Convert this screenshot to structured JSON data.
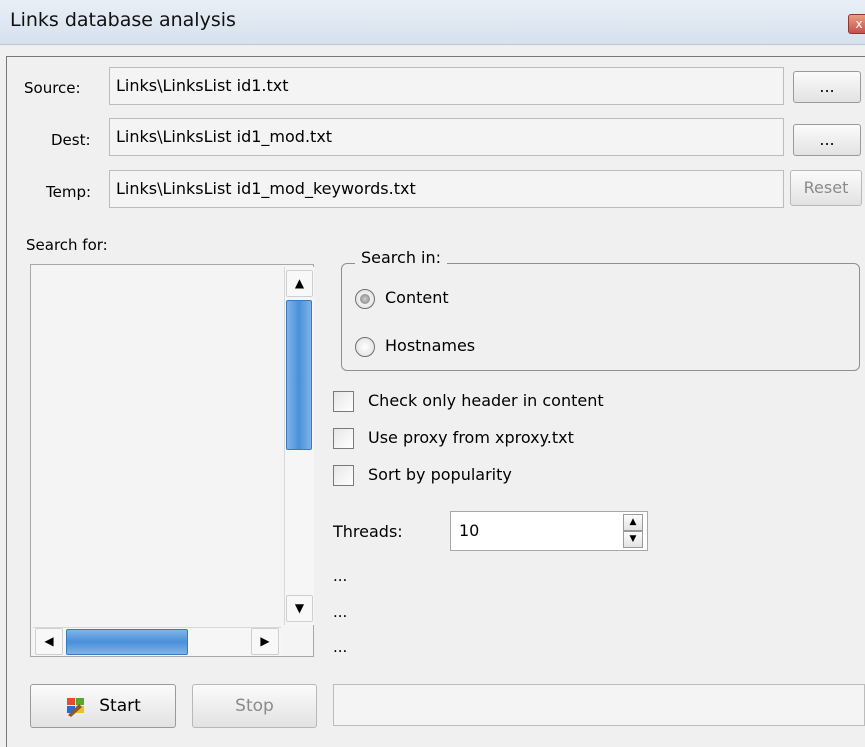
{
  "window": {
    "title": "Links database analysis",
    "close_glyph": "x"
  },
  "source": {
    "label": "Source:",
    "value": "Links\\LinksList id1.txt",
    "browse_label": "..."
  },
  "dest": {
    "label": "Dest:",
    "value": "Links\\LinksList id1_mod.txt",
    "browse_label": "..."
  },
  "temp": {
    "label": "Temp:",
    "value": "Links\\LinksList id1_mod_keywords.txt",
    "reset_label": "Reset"
  },
  "search_for": {
    "label": "Search for:",
    "items": []
  },
  "search_in": {
    "legend": "Search in:",
    "options": [
      {
        "label": "Content",
        "selected": true
      },
      {
        "label": "Hostnames",
        "selected": false
      }
    ]
  },
  "options": {
    "check_header": {
      "label": "Check only header in content",
      "checked": false
    },
    "use_proxy": {
      "label": "Use proxy from xproxy.txt",
      "checked": false
    },
    "sort_popularity": {
      "label": "Sort by popularity",
      "checked": false
    }
  },
  "threads": {
    "label": "Threads:",
    "value": "10"
  },
  "status_lines": [
    "...",
    "...",
    "..."
  ],
  "buttons": {
    "start": "Start",
    "stop": "Stop"
  },
  "status_box": {
    "text": ""
  },
  "icons": {
    "start_icon": "start-icon",
    "scroll_up": "▲",
    "scroll_down": "▼",
    "scroll_left": "◀",
    "scroll_right": "▶"
  }
}
